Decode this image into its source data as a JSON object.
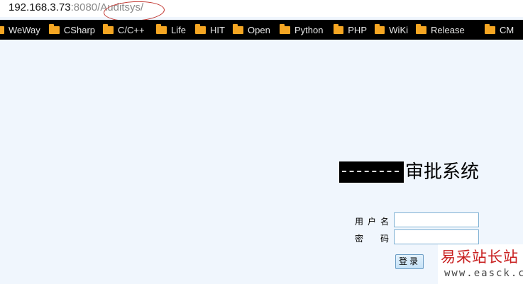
{
  "browser": {
    "url_host": "192.168.3.73",
    "url_rest": ":8080/Auditsys/",
    "bookmarks": [
      "WeWay",
      "CSharp",
      "C/C++",
      "Life",
      "HIT",
      "Open",
      "Python",
      "PHP",
      "WiKi",
      "Release",
      "CM"
    ]
  },
  "page": {
    "title": "审批系统",
    "username_label": "用户名",
    "password_label": "密码",
    "username_value": "",
    "password_value": "",
    "login_button": "登录"
  },
  "watermark": {
    "title": "易采站长站",
    "url": "www.easck.com"
  },
  "colors": {
    "page_background": "#f0f6fd",
    "bookmark_bar": "#000000",
    "folder_icon": "#f5a623",
    "annotation": "#c0312b",
    "watermark_title": "#c81f1f"
  }
}
